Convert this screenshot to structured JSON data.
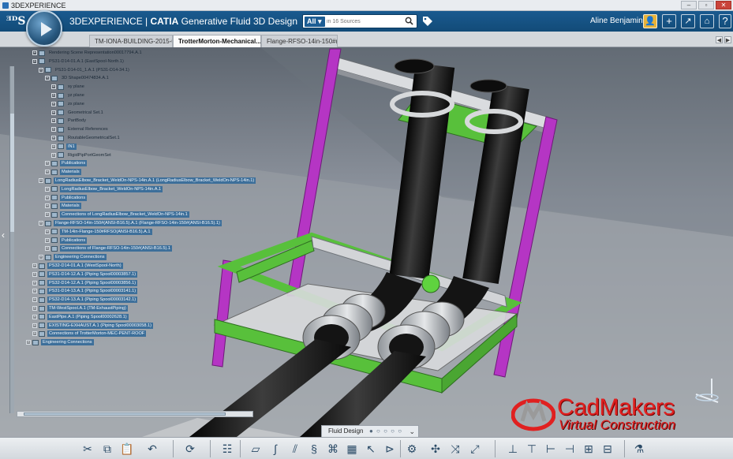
{
  "window": {
    "title": "3DEXPERIENCE"
  },
  "header": {
    "brand_prefix": "3DEXPERIENCE | ",
    "brand_app": "CATIA",
    "brand_suffix": " Generative Fluid 3D Design",
    "search_scope": "All",
    "search_placeholder": "in 16 Sources",
    "user_name": "Aline Benjamin"
  },
  "tabs": [
    {
      "label": "TM-IONA-BUILDING-2015-01..."
    },
    {
      "label": "TrotterMorton-Mechanical...",
      "close": "✕"
    },
    {
      "label": "Flange-RFSO-14in-150#(AN..."
    }
  ],
  "tree": [
    {
      "label": "Rendering Scene Representation00017794.A.1",
      "sel": false
    },
    {
      "label": "PS31-D14-01.A.1 (EastSpool-North.1)",
      "sel": false
    },
    {
      "label": "PS31-D14-01_1.A.1 (PS31-D14-34.1)",
      "sel": false
    },
    {
      "label": "3D Shape00474834.A.1",
      "sel": false
    },
    {
      "label": "xy plane",
      "sel": false
    },
    {
      "label": "yz plane",
      "sel": false
    },
    {
      "label": "zx plane",
      "sel": false
    },
    {
      "label": "Geometrical Set.1",
      "sel": false
    },
    {
      "label": "PartBody",
      "sel": false
    },
    {
      "label": "External References",
      "sel": false
    },
    {
      "label": "RoutableGeometricalSet.1",
      "sel": false
    },
    {
      "label": "IN1",
      "sel": true
    },
    {
      "label": "RigidPipPortGeomSet",
      "sel": false
    },
    {
      "label": "Publications",
      "sel": true
    },
    {
      "label": "Materials",
      "sel": true
    },
    {
      "label": "LongRadiusElbow_Bracket_WeldOn-NPS-14in.A.1 (LongRadiusElbow_Bracket_WeldOn-NPS-14in.1)",
      "sel": true
    },
    {
      "label": "LongRadiusElbow_Bracket_WeldOn-NPS-14in.A.1",
      "sel": true
    },
    {
      "label": "Publications",
      "sel": true
    },
    {
      "label": "Materials",
      "sel": true
    },
    {
      "label": "Connections of LongRadiusElbow_Bracket_WeldOn-NPS-14in.1",
      "sel": true
    },
    {
      "label": "Flange-RFSO-14in-150#(ANSI-B16.5).A.1 (Flange-RFSO-14in-150#(ANSI-B16.5).1)",
      "sel": true
    },
    {
      "label": "TM-14in-Flange-150#RFSO(ANSI-B16.5).A.1",
      "sel": true
    },
    {
      "label": "Publications",
      "sel": true
    },
    {
      "label": "Connections of Flange-RFSO-14in-150#(ANSI-B16.5).1",
      "sel": true
    },
    {
      "label": "Engineering Connections",
      "sel": true
    },
    {
      "label": "PS32-D14-01.A.1 (WestSpool-North)",
      "sel": true
    },
    {
      "label": "PS31-D14-12.A.1 (Piping Spool00003857.1)",
      "sel": true
    },
    {
      "label": "PS32-D14-12.A.1 (Piping Spool00003856.1)",
      "sel": true
    },
    {
      "label": "PS31-D14-13.A.1 (Piping Spool00003141.1)",
      "sel": true
    },
    {
      "label": "PS32-D14-13.A.1 (Piping Spool00003142.1)",
      "sel": true
    },
    {
      "label": "TM-WestSpool.A.1 (TM-ExhaustPiping)",
      "sel": true
    },
    {
      "label": "EastPipe.A.1 (Piping Spool00002628.1)",
      "sel": true
    },
    {
      "label": "EXISTING-EXHAUST.A.1 (Piping Spool00003058.1)",
      "sel": true
    },
    {
      "label": "Connections of TrotterMorton-MEC-PENT-ROOF",
      "sel": true
    },
    {
      "label": "Engineering Connections",
      "sel": true
    }
  ],
  "logo": {
    "word": "CadMakers",
    "sub": "Virtual Construction"
  },
  "actionbar": {
    "section_label": "Fluid Design",
    "dots": "● ○ ○ ○ ○"
  },
  "colors": {
    "header": "#1a5a8f",
    "support_green": "#6bd14a",
    "support_magenta": "#b535c4",
    "pipe": "#1b1b1b"
  }
}
